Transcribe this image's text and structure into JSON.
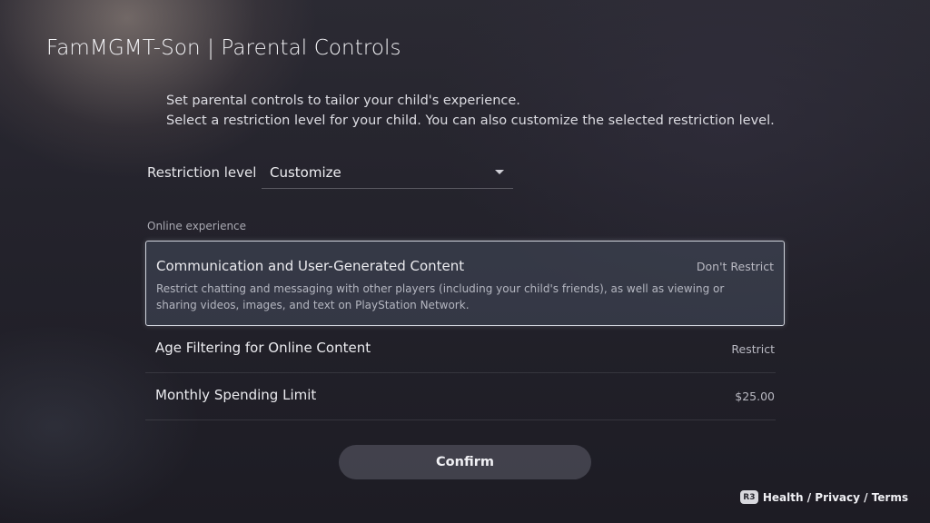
{
  "header": {
    "title": "FamMGMT-Son | Parental Controls"
  },
  "intro": {
    "line1": "Set parental controls to tailor your child's experience.",
    "line2": "Select a restriction level for your child. You can also customize the selected restriction level."
  },
  "restriction": {
    "label": "Restriction level",
    "selected_value": "Customize"
  },
  "online_section": {
    "label": "Online experience",
    "items": [
      {
        "name": "Communication and User-Generated Content",
        "value": "Don't Restrict",
        "description": "Restrict chatting and messaging with other players (including your child's friends), as well as viewing or sharing videos, images, and text on PlayStation Network."
      },
      {
        "name": "Age Filtering for Online Content",
        "value": "Restrict"
      },
      {
        "name": "Monthly Spending Limit",
        "value": "$25.00"
      }
    ]
  },
  "confirm_label": "Confirm",
  "footer": {
    "button_glyph": "R3",
    "link_text": "Health / Privacy / Terms"
  }
}
